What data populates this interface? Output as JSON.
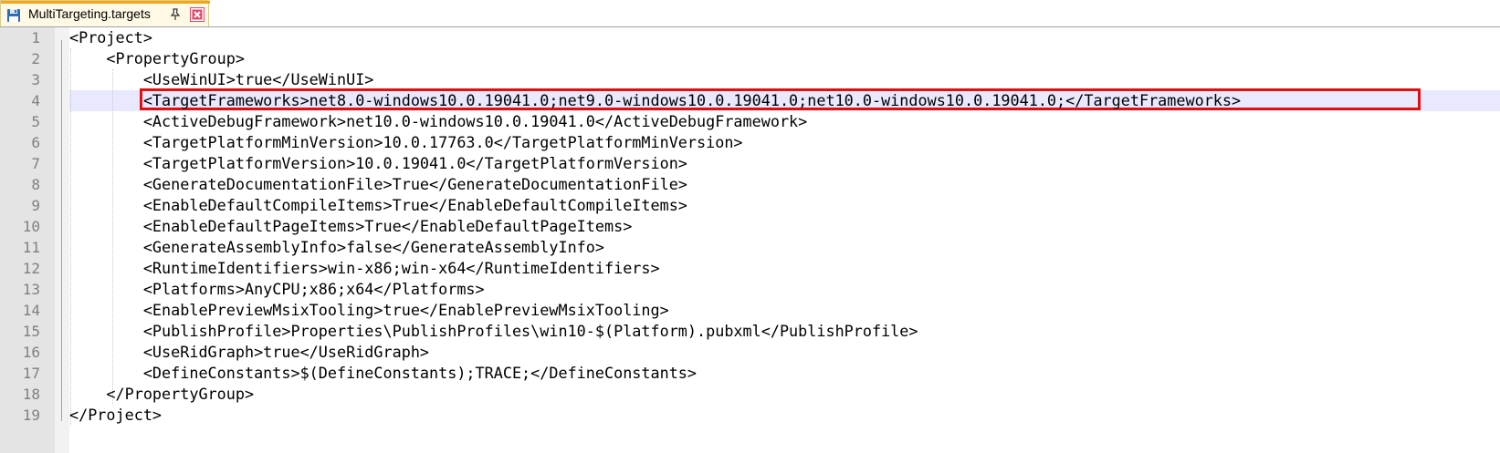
{
  "tab": {
    "title": "MultiTargeting.targets",
    "file_icon": "floppy-disk-icon",
    "pin_icon": "pin-icon",
    "close_icon": "close-icon",
    "accent_color": "#f7a518",
    "close_color": "#e04a6a"
  },
  "editor": {
    "current_line": 4,
    "highlighted_line": 4,
    "highlight_color": "#e01010",
    "lines": [
      {
        "num": "1",
        "text": "<Project>"
      },
      {
        "num": "2",
        "text": "    <PropertyGroup>"
      },
      {
        "num": "3",
        "text": "        <UseWinUI>true</UseWinUI>"
      },
      {
        "num": "4",
        "text": "        <TargetFrameworks>net8.0-windows10.0.19041.0;net9.0-windows10.0.19041.0;net10.0-windows10.0.19041.0;</TargetFrameworks>"
      },
      {
        "num": "5",
        "text": "        <ActiveDebugFramework>net10.0-windows10.0.19041.0</ActiveDebugFramework>"
      },
      {
        "num": "6",
        "text": "        <TargetPlatformMinVersion>10.0.17763.0</TargetPlatformMinVersion>"
      },
      {
        "num": "7",
        "text": "        <TargetPlatformVersion>10.0.19041.0</TargetPlatformVersion>"
      },
      {
        "num": "8",
        "text": "        <GenerateDocumentationFile>True</GenerateDocumentationFile>"
      },
      {
        "num": "9",
        "text": "        <EnableDefaultCompileItems>True</EnableDefaultCompileItems>"
      },
      {
        "num": "10",
        "text": "        <EnableDefaultPageItems>True</EnableDefaultPageItems>"
      },
      {
        "num": "11",
        "text": "        <GenerateAssemblyInfo>false</GenerateAssemblyInfo>"
      },
      {
        "num": "12",
        "text": "        <RuntimeIdentifiers>win-x86;win-x64</RuntimeIdentifiers>"
      },
      {
        "num": "13",
        "text": "        <Platforms>AnyCPU;x86;x64</Platforms>"
      },
      {
        "num": "14",
        "text": "        <EnablePreviewMsixTooling>true</EnablePreviewMsixTooling>"
      },
      {
        "num": "15",
        "text": "        <PublishProfile>Properties\\PublishProfiles\\win10-$(Platform).pubxml</PublishProfile>"
      },
      {
        "num": "16",
        "text": "        <UseRidGraph>true</UseRidGraph>"
      },
      {
        "num": "17",
        "text": "        <DefineConstants>$(DefineConstants);TRACE;</DefineConstants>"
      },
      {
        "num": "18",
        "text": "    </PropertyGroup>"
      },
      {
        "num": "19",
        "text": "</Project>"
      }
    ]
  }
}
